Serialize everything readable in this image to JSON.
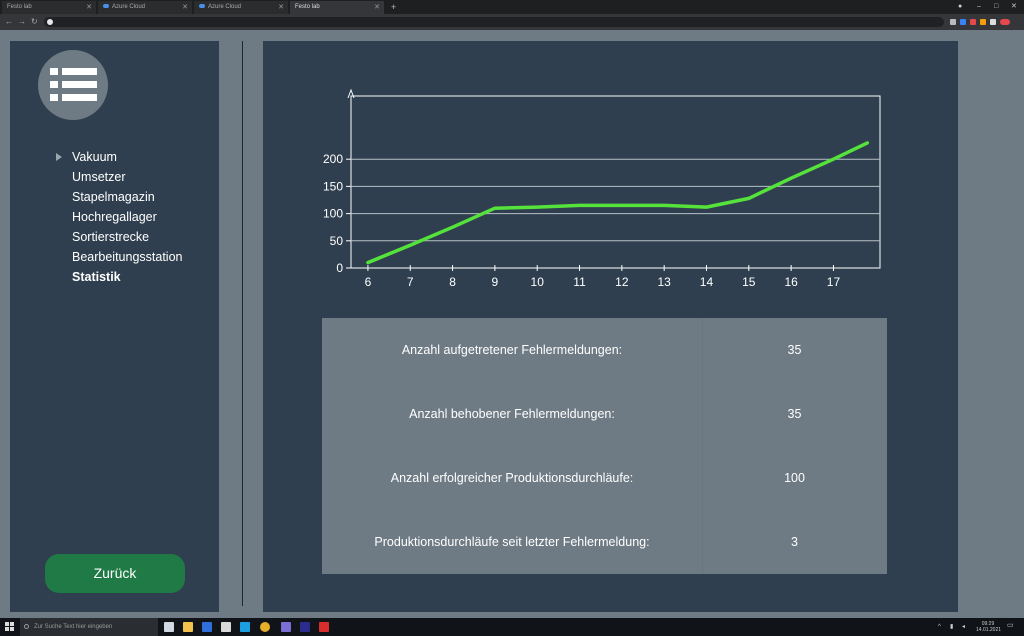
{
  "browser": {
    "tabs": [
      {
        "title": "Festo lab",
        "active": false
      },
      {
        "title": "Azure Cloud",
        "active": false
      },
      {
        "title": "Azure Cloud",
        "active": false
      },
      {
        "title": "Festo lab",
        "active": true
      }
    ],
    "new_tab": "+",
    "window_controls": [
      "–",
      "□",
      "✕"
    ],
    "nav": {
      "back": "←",
      "forward": "→",
      "reload": "↻"
    }
  },
  "sidebar": {
    "menu_icon": "list-icon",
    "items": [
      {
        "label": "Vakuum",
        "marker": true,
        "active": false
      },
      {
        "label": "Umsetzer",
        "marker": false,
        "active": false
      },
      {
        "label": "Stapelmagazin",
        "marker": false,
        "active": false
      },
      {
        "label": "Hochregallager",
        "marker": false,
        "active": false
      },
      {
        "label": "Sortierstrecke",
        "marker": false,
        "active": false
      },
      {
        "label": "Bearbeitungsstation",
        "marker": false,
        "active": false
      },
      {
        "label": "Statistik",
        "marker": false,
        "active": true
      }
    ],
    "back_label": "Zurück"
  },
  "chart_data": {
    "type": "line",
    "x": [
      6,
      7,
      8,
      9,
      10,
      11,
      12,
      13,
      14,
      15,
      16,
      17,
      17.8
    ],
    "series": [
      {
        "values": [
          10,
          42,
          75,
          110,
          112,
          115,
          115,
          115,
          112,
          128,
          165,
          200,
          230
        ],
        "color": "#55e23b"
      }
    ],
    "x_ticks": [
      "6",
      "7",
      "8",
      "9",
      "10",
      "11",
      "12",
      "13",
      "14",
      "15",
      "16",
      "17"
    ],
    "y_ticks": [
      "0",
      "50",
      "100",
      "150",
      "200"
    ],
    "ylim": [
      0,
      250
    ],
    "grid": true,
    "colors": {
      "line": "#55e23b",
      "axis": "#ffffff",
      "grid": "#b8c0c6"
    }
  },
  "stats": [
    {
      "label": "Anzahl aufgetretener Fehlermeldungen:",
      "value": "35"
    },
    {
      "label": "Anzahl behobener Fehlermeldungen:",
      "value": "35"
    },
    {
      "label": "Anzahl erfolgreicher Produktionsdurchläufe:",
      "value": "100"
    },
    {
      "label": "Produktionsdurchläufe seit letzter Fehlermeldung:",
      "value": "3"
    }
  ],
  "taskbar": {
    "search_placeholder": "Zur Suche Text hier eingeben",
    "time": "09:29",
    "date": "14.01.2021"
  },
  "colors": {
    "page_bg": "#6f7b84",
    "panel_bg": "#2f3f4f",
    "button_bg": "#1f7a45",
    "stats_bg": "#6f7b84"
  }
}
